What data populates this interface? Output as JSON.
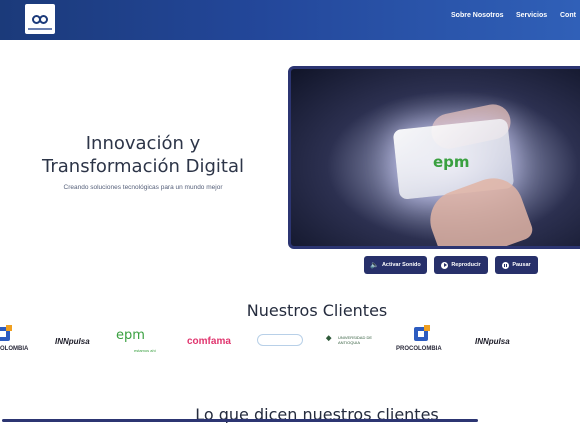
{
  "header": {
    "nav": [
      "Sobre Nosotros",
      "Servicios",
      "Cont"
    ]
  },
  "hero": {
    "title_line1": "Innovación y",
    "title_line2": "Transformación Digital",
    "subtitle": "Creando soluciones tecnológicas para un mundo mejor"
  },
  "video": {
    "brand": "epm"
  },
  "controls": {
    "sound_label": "Activar Sonido",
    "play_label": "Reproducir",
    "pause_label": "Pausar"
  },
  "clients": {
    "title": "Nuestros Clientes",
    "logos": [
      "OLOMBIA",
      "INNpulsa",
      "epm",
      "estamos ahí",
      "comfama",
      "UNIVERSIDAD DE ANTIOQUIA",
      "PROCOLOMBIA",
      "INNpulsa"
    ]
  },
  "testimonials": {
    "title": "Lo que dicen nuestros clientes"
  },
  "colors": {
    "header_start": "#1b3a7a",
    "header_end": "#3060b8",
    "button_bg": "#27306a",
    "epm_green": "#3aa040",
    "comfama_pink": "#e0356e"
  }
}
